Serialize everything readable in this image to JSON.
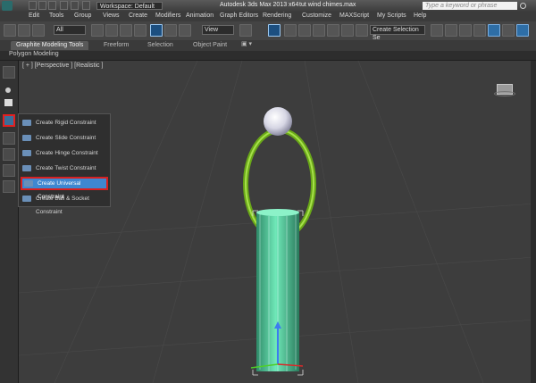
{
  "titlebar": {
    "workspace": "Workspace: Default",
    "app_title": "Autodesk 3ds Max  2013 x64",
    "document": "tut wind chimes.max",
    "search_placeholder": "Type a keyword or phrase"
  },
  "menu": [
    "Edit",
    "Tools",
    "Group",
    "Views",
    "Create",
    "Modifiers",
    "Animation",
    "Graph Editors",
    "Rendering",
    "Customize",
    "MAXScript",
    "My Scripts",
    "Help"
  ],
  "toolbar": {
    "selection_filter": "All",
    "reference_coord": "View",
    "named_selection": "Create Selection Se"
  },
  "ribbon": {
    "tabs": [
      "Graphite Modeling Tools",
      "Freeform",
      "Selection",
      "Object Paint"
    ],
    "active_tab": "Graphite Modeling Tools",
    "panel": "Polygon Modeling"
  },
  "viewport": {
    "label": "[ + ] [Perspective ] [Realistic ]"
  },
  "flyout": {
    "items": [
      "Create Rigid Constraint",
      "Create Slide Constraint",
      "Create Hinge Constraint",
      "Create Twist Constraint",
      "Create Universal Constraint",
      "Create Ball & Socket Constraint"
    ],
    "highlighted": "Create Universal Constraint"
  },
  "colors": {
    "accent": "#3e87d0",
    "highlight_border": "#d82020",
    "ring": "#7fbf1e",
    "cylinder": "#5fd7a6",
    "viewport_bg": "#3d3d3d"
  }
}
